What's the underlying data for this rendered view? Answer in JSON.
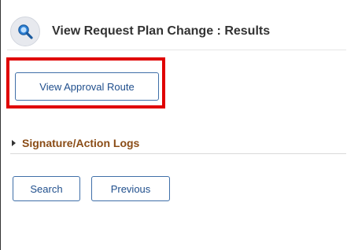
{
  "header": {
    "title": "View Request Plan Change :  Results",
    "icon": "search-icon"
  },
  "actions": {
    "view_approval_route_label": "View Approval Route"
  },
  "sections": [
    {
      "label": "Signature/Action Logs",
      "expanded": false
    }
  ],
  "footer": {
    "search_label": "Search",
    "previous_label": "Previous"
  },
  "colors": {
    "highlight": "#e00000",
    "button_text": "#1f4e8c",
    "button_border": "#3f6fa8",
    "section_label": "#8a4c16"
  }
}
